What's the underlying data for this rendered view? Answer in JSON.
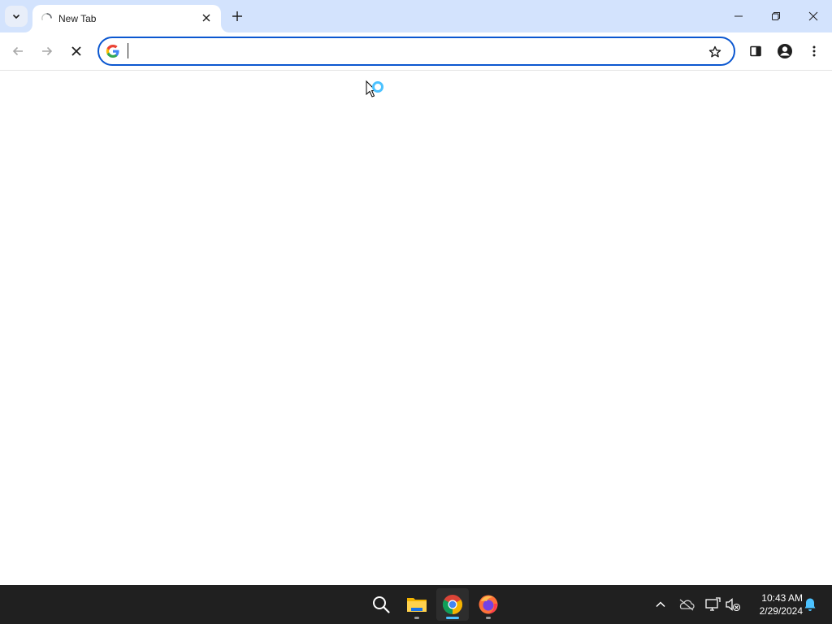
{
  "window": {
    "tab": {
      "title": "New Tab",
      "loading": true
    },
    "controls": {
      "minimize": "minimize",
      "restore": "restore",
      "close": "close"
    }
  },
  "toolbar": {
    "omnibox": {
      "value": "",
      "placeholder": ""
    },
    "icons": [
      "back-icon",
      "forward-icon",
      "stop-icon",
      "google-icon",
      "bookmark-star-icon",
      "side-panel-icon",
      "profile-icon",
      "menu-icon"
    ]
  },
  "taskbar": {
    "apps": [
      "search-icon",
      "file-explorer-icon",
      "chrome-icon",
      "firefox-icon"
    ],
    "tray": [
      "chevron-up-icon",
      "onedrive-icon",
      "network-icon",
      "volume-muted-icon",
      "notification-bell-icon"
    ],
    "clock": {
      "time": "10:43 AM",
      "date": "2/29/2024"
    }
  },
  "colors": {
    "tabstrip": "#d3e3fd",
    "accent": "#0b57d0",
    "taskbar": "#202020",
    "notification": "#4cc2ff"
  }
}
